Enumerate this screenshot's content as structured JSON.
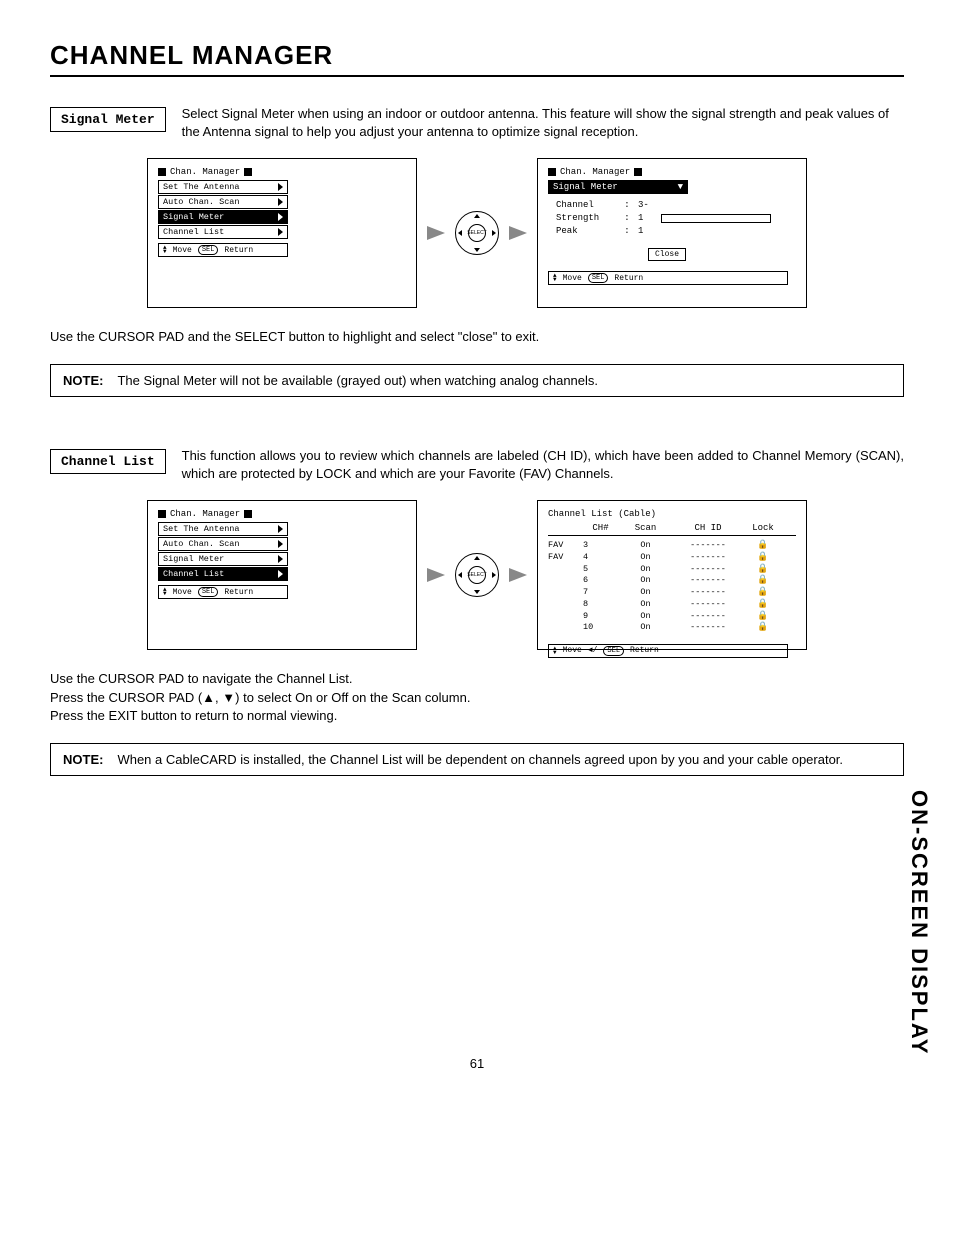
{
  "page_title": "CHANNEL MANAGER",
  "side_label": "ON-SCREEN DISPLAY",
  "page_number": "61",
  "section1": {
    "label": "Signal Meter",
    "desc": "Select Signal Meter when using an indoor or outdoor antenna.  This feature will show the signal strength and peak values of the Antenna signal to help  you adjust your antenna to optimize signal reception.",
    "dpad_label": "SELECT",
    "menu_title": "Chan. Manager",
    "menu_items": [
      "Set The Antenna",
      "Auto Chan. Scan",
      "Signal Meter",
      "Channel List"
    ],
    "menu_selected_index": 2,
    "footer_move": "Move",
    "footer_sel": "SEL",
    "footer_return": "Return",
    "right_title": "Chan. Manager",
    "right_sub": "Signal Meter",
    "readouts": {
      "channel_label": "Channel",
      "channel_val": "3-",
      "strength_label": "Strength",
      "strength_val": "1",
      "peak_label": "Peak",
      "peak_val": "1"
    },
    "close": "Close",
    "instruction": "Use the CURSOR PAD and the SELECT button to highlight and select \"close\" to exit.",
    "note_label": "NOTE:",
    "note_text": "The Signal Meter will not be available (grayed out) when watching analog channels."
  },
  "section2": {
    "label": "Channel List",
    "desc": "This function allows you to review which channels are labeled (CH ID), which have been added to Channel Memory (SCAN), which are protected by LOCK and which are your Favorite (FAV) Channels.",
    "dpad_label": "SELECT",
    "menu_title": "Chan. Manager",
    "menu_items": [
      "Set The Antenna",
      "Auto Chan. Scan",
      "Signal Meter",
      "Channel List"
    ],
    "menu_selected_index": 3,
    "footer_move": "Move",
    "footer_sel": "SEL",
    "footer_return": "Return",
    "right_title": "Channel List (Cable)",
    "columns": {
      "ch": "CH#",
      "scan": "Scan",
      "chid": "CH ID",
      "lock": "Lock"
    },
    "rows": [
      {
        "fav": "FAV",
        "ch": "3",
        "scan": "On",
        "chid": "-------",
        "lock": true
      },
      {
        "fav": "FAV",
        "ch": "4",
        "scan": "On",
        "chid": "-------",
        "lock": true
      },
      {
        "fav": "",
        "ch": "5",
        "scan": "On",
        "chid": "-------",
        "lock": true
      },
      {
        "fav": "",
        "ch": "6",
        "scan": "On",
        "chid": "-------",
        "lock": true
      },
      {
        "fav": "",
        "ch": "7",
        "scan": "On",
        "chid": "-------",
        "lock": true
      },
      {
        "fav": "",
        "ch": "8",
        "scan": "On",
        "chid": "-------",
        "lock": true
      },
      {
        "fav": "",
        "ch": "9",
        "scan": "On",
        "chid": "-------",
        "lock": true
      },
      {
        "fav": "",
        "ch": "10",
        "scan": "On",
        "chid": "-------",
        "lock": true
      }
    ],
    "instruction1": "Use the CURSOR PAD to navigate the Channel List.",
    "instruction2": "Press the CURSOR PAD (▲, ▼) to select On or Off on the Scan column.",
    "instruction3": "Press the EXIT button to return to normal viewing.",
    "note_label": "NOTE:",
    "note_text": "When a CableCARD is installed, the Channel List will be dependent on channels agreed upon by you and your cable operator."
  }
}
